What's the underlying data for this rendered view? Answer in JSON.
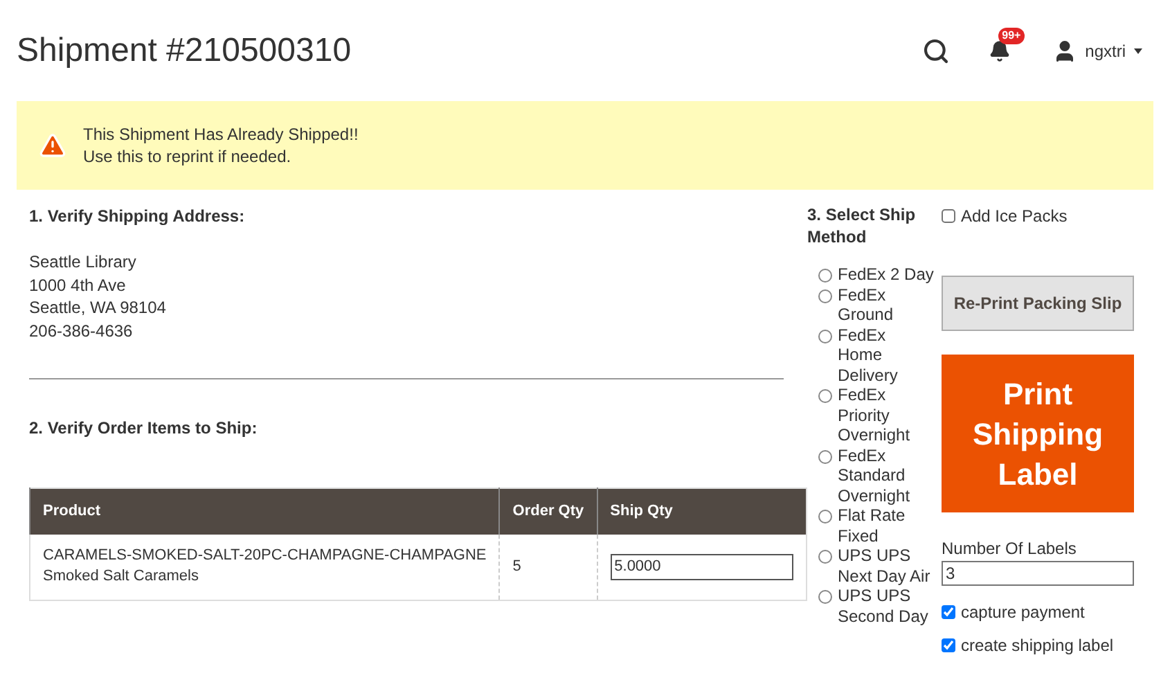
{
  "header": {
    "title": "Shipment #210500310",
    "notifications_badge": "99+",
    "user": "ngxtri"
  },
  "message": {
    "lines": [
      "This Shipment Has Already Shipped!!",
      "Use this to reprint if needed."
    ]
  },
  "address": {
    "heading": "1. Verify Shipping Address:",
    "lines": [
      "Seattle Library",
      "1000 4th Ave",
      "Seattle, WA 98104",
      "206-386-4636"
    ]
  },
  "items": {
    "heading": "2. Verify Order Items to Ship:",
    "columns": [
      "Product",
      "Order Qty",
      "Ship Qty"
    ],
    "rows": [
      {
        "sku": "CARAMELS-SMOKED-SALT-20PC-CHAMPAGNE-CHAMPAGNE",
        "name": "Smoked Salt Caramels",
        "order_qty": "5",
        "ship_qty": "5.0000"
      }
    ]
  },
  "ship_method": {
    "heading": "3. Select Ship Method",
    "options": [
      {
        "label": "FedEx 2 Day",
        "selected": false
      },
      {
        "label": "FedEx Ground",
        "selected": false
      },
      {
        "label": "FedEx Home Delivery",
        "selected": false
      },
      {
        "label": "FedEx Priority Overnight",
        "selected": false
      },
      {
        "label": "FedEx Standard Overnight",
        "selected": false
      },
      {
        "label": "Flat Rate Fixed",
        "selected": false
      },
      {
        "label": "UPS UPS Next Day Air",
        "selected": false
      },
      {
        "label": "UPS UPS Second Day",
        "selected": false
      }
    ]
  },
  "actions": {
    "ice_packs": {
      "label": "Add Ice Packs",
      "checked": false
    },
    "reprint_button": "Re-Print Packing Slip",
    "print_button": "Print Shipping Label",
    "labels_field": {
      "label": "Number Of Labels",
      "value": "3"
    },
    "options": [
      {
        "label": "capture payment",
        "checked": true
      },
      {
        "label": "create shipping label",
        "checked": true
      }
    ]
  }
}
